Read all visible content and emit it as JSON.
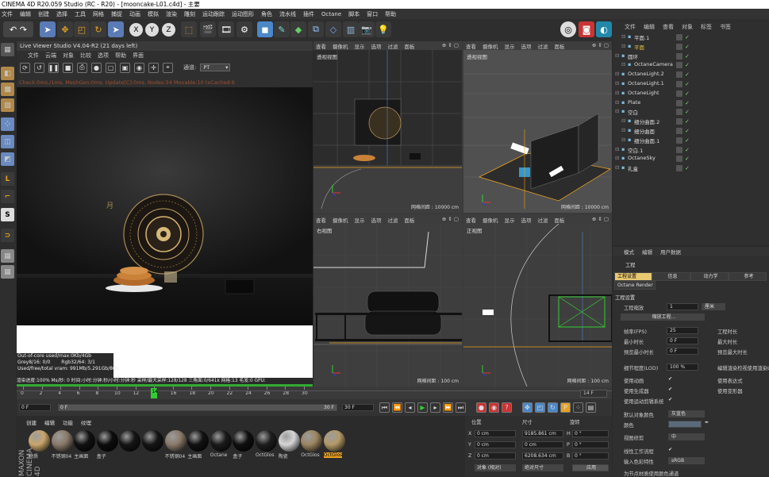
{
  "window": {
    "title": "CINEMA 4D R20.059 Studio (RC - R20) - [mooncake-L01.c4d] - 主要"
  },
  "menubar": [
    "文件",
    "编辑",
    "创建",
    "选择",
    "工具",
    "网格",
    "捕捉",
    "动画",
    "模拟",
    "渲染",
    "雕刻",
    "运动跟踪",
    "运动图形",
    "角色",
    "流水线",
    "插件",
    "Octane",
    "脚本",
    "窗口",
    "帮助"
  ],
  "live_viewer": {
    "title": "Live Viewer Studio V4.04-R2 (21 days left)",
    "menu": [
      "文件",
      "云端",
      "对象",
      "比较",
      "选项",
      "帮助",
      "界面"
    ],
    "channel_label": "通道:",
    "channel_value": "PT",
    "status": "Check:0ms./1ms. MeshGen:0ms. Update[C]:0ms. Nodes:54 Movable:10 txCached:6",
    "stats": {
      "out_of_core": "Out-of-core used/max:0Kb/4Gb",
      "grey": "Grey8/16: 0/0",
      "rgb": "Rgb32/64: 3/1",
      "vram": "Used/free/total vram: 991Mb/5.291Gb/8Gb"
    },
    "progress": "渲染进度:100%   Ms/秒: 0   时间:小时:分钟:秒/小时:分钟:秒   采样/最大采样:128/128   三角面:0/641k   网格:13   毛发:0   GPU:"
  },
  "viewports": [
    {
      "menu": [
        "查看",
        "摄像机",
        "显示",
        "选项",
        "过滤",
        "面板"
      ],
      "name": "透视视图",
      "grid": "网格间距 : 10000 cm"
    },
    {
      "menu": [
        "查看",
        "摄像机",
        "显示",
        "选项",
        "过滤",
        "面板"
      ],
      "name": "透视视图",
      "grid": "网格间距 : 10000 cm"
    },
    {
      "menu": [
        "查看",
        "摄像机",
        "显示",
        "选项",
        "过滤",
        "面板"
      ],
      "name": "右视图",
      "grid": "网格间距 : 100 cm"
    },
    {
      "menu": [
        "查看",
        "摄像机",
        "显示",
        "选项",
        "过滤",
        "面板"
      ],
      "name": "正视图",
      "grid": "网格间距 : 100 cm"
    }
  ],
  "object_manager": {
    "menu": [
      "文件",
      "编辑",
      "查看",
      "对象",
      "标签",
      "书签"
    ],
    "objects": [
      {
        "name": "平面.1",
        "indent": 1,
        "color": "#ddd"
      },
      {
        "name": "平面",
        "indent": 1,
        "color": "#e8c040"
      },
      {
        "name": "圆环",
        "indent": 0,
        "color": "#ddd"
      },
      {
        "name": "OctaneCamera",
        "indent": 1,
        "color": "#ddd"
      },
      {
        "name": "OctaneLight.2",
        "indent": 0,
        "color": "#ddd"
      },
      {
        "name": "OctaneLight.1",
        "indent": 0,
        "color": "#ddd"
      },
      {
        "name": "OctaneLight",
        "indent": 0,
        "color": "#ddd"
      },
      {
        "name": "Plate",
        "indent": 0,
        "color": "#ddd"
      },
      {
        "name": "空白",
        "indent": 0,
        "color": "#ddd"
      },
      {
        "name": "细分曲面.2",
        "indent": 1,
        "color": "#ddd"
      },
      {
        "name": "细分曲面",
        "indent": 1,
        "color": "#ddd"
      },
      {
        "name": "细分曲面.1",
        "indent": 1,
        "color": "#ddd"
      },
      {
        "name": "空白.1",
        "indent": 0,
        "color": "#ddd"
      },
      {
        "name": "OctaneSky",
        "indent": 0,
        "color": "#ddd"
      },
      {
        "name": "礼盒",
        "indent": 0,
        "color": "#ddd"
      }
    ]
  },
  "attributes": {
    "tabs": [
      "模式",
      "编辑",
      "用户数据"
    ],
    "section": "工程",
    "subtabs": [
      "工程设置",
      "信息",
      "动力学",
      "参考"
    ],
    "octane_tab": "Octane Render",
    "heading": "工程设置",
    "scale_label": "工程缩放",
    "scale_value": "1",
    "scale_unit": "厘米",
    "scale_button": "缩放工程...",
    "fps_label": "帧率(FPS)",
    "fps_value": "25",
    "proj_time_label": "工程时长",
    "min_time_label": "最小时长",
    "min_time_value": "0 F",
    "max_time_label": "最大时长",
    "preview_min_label": "预览最小时长",
    "preview_min_value": "0 F",
    "preview_max_label": "预览最大时长",
    "lod_label": "细节程度(LOD)",
    "lod_value": "100 %",
    "editor_lod_label": "编辑渲染检视使用渲染LOD",
    "use_anim_label": "使用动画",
    "use_expr_label": "使用表达式",
    "use_gen_label": "使用生成器",
    "use_deform_label": "使用变形器",
    "use_motion_label": "使用运动剪辑系统",
    "default_color_label": "默认对象颜色",
    "default_color_value": "灰蓝色",
    "color_label": "颜色",
    "view_clip_label": "视图修剪",
    "view_clip_value": "中",
    "linear_label": "线性工作流程",
    "input_color_label": "输入色彩特性",
    "input_color_value": "sRGB",
    "node_color_label": "为节点材质使用颜色通道"
  },
  "timeline": {
    "ticks": [
      "0",
      "2",
      "4",
      "6",
      "8",
      "10",
      "12",
      "14",
      "16",
      "18",
      "20",
      "22",
      "24",
      "26",
      "28",
      "30"
    ],
    "current_frame": "14",
    "end_frame_label": "14 F",
    "start_field": "0 F",
    "range_start": "0 F",
    "range_end": "30 F",
    "end_field": "30 F"
  },
  "material_manager": {
    "menu": [
      "创建",
      "编辑",
      "功能",
      "纹理"
    ],
    "materials": [
      {
        "name": "材质",
        "color": "#c9a66b"
      },
      {
        "name": "不锈钢04",
        "color": "#8a7a6a"
      },
      {
        "name": "主画面",
        "color": "#111"
      },
      {
        "name": "盒子",
        "color": "#0d0d0d"
      },
      {
        "name": "",
        "color": "#151515"
      },
      {
        "name": "",
        "color": "#151515"
      },
      {
        "name": "不锈钢04",
        "color": "#8a7a6a"
      },
      {
        "name": "主画面",
        "color": "#111"
      },
      {
        "name": "Octane",
        "color": "#1a1a1a"
      },
      {
        "name": "盒子",
        "color": "#0f0f0f"
      },
      {
        "name": "OctGlos",
        "color": "#1e1e1e"
      },
      {
        "name": "陶瓷",
        "color": "#d6d6d6"
      },
      {
        "name": "OctGlos",
        "color": "#9c8660"
      },
      {
        "name": "OctGlos",
        "color": "#b59a68"
      }
    ]
  },
  "coordinates": {
    "headers": [
      "位置",
      "尺寸",
      "旋转"
    ],
    "x": {
      "pos": "0 cm",
      "size": "9185.861 cm",
      "rot_label": "H",
      "rot": "0 °"
    },
    "y": {
      "pos": "0 cm",
      "size": "0 cm",
      "rot_label": "P",
      "rot": "0 °"
    },
    "z": {
      "pos": "0 cm",
      "size": "6208.634 cm",
      "rot_label": "B",
      "rot": "0 °"
    },
    "mode": "对象 (相对)",
    "size_mode": "绝对尺寸",
    "apply": "应用"
  },
  "colors": {
    "accent": "#e8a020",
    "selection": "#4a88c8"
  }
}
